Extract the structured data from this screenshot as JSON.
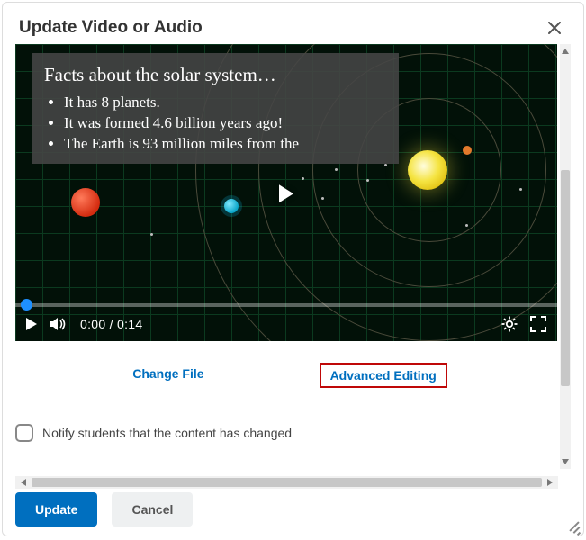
{
  "dialog": {
    "title": "Update Video or Audio"
  },
  "video": {
    "caption_title": "Facts about the solar system…",
    "caption_items": [
      "It has 8 planets.",
      "It was formed 4.6 billion years ago!",
      "The Earth is 93 million miles from the"
    ],
    "time_display": "0:00 / 0:14"
  },
  "actions": {
    "change_file": "Change File",
    "advanced_editing": "Advanced Editing"
  },
  "notify": {
    "label": "Notify students that the content has changed",
    "checked": false
  },
  "footer": {
    "update": "Update",
    "cancel": "Cancel"
  }
}
